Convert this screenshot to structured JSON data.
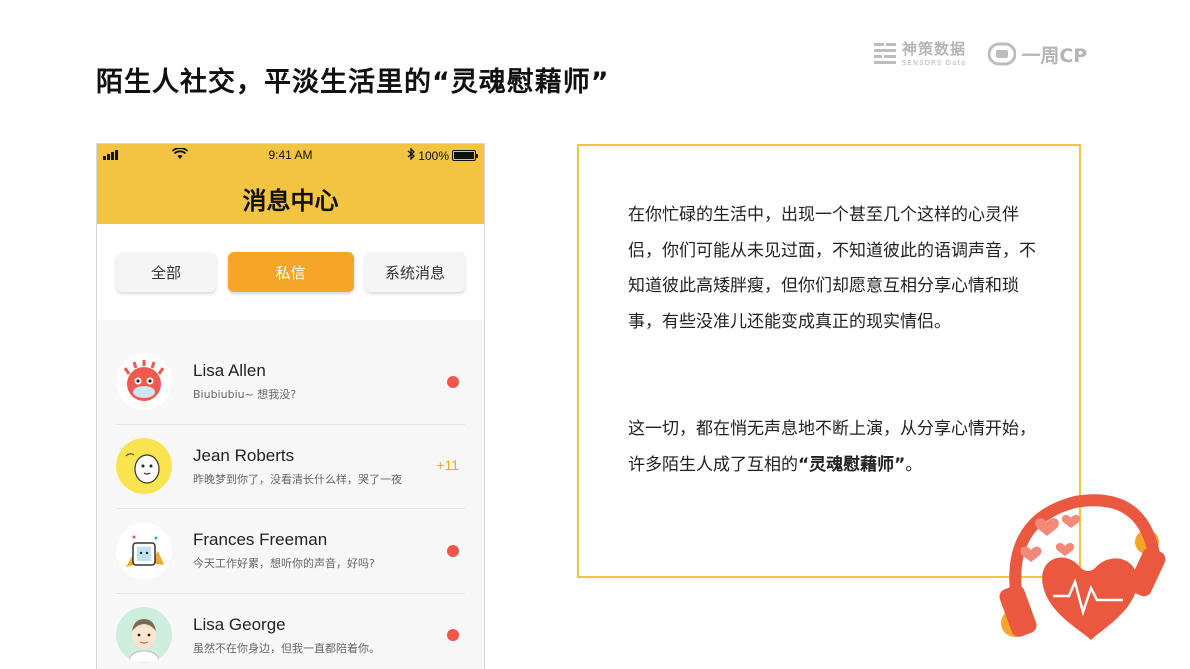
{
  "slide": {
    "title": "陌生人社交，平淡生活里的“灵魂慰藉师”"
  },
  "logos": {
    "sensors_cn": "神策数据",
    "sensors_en": "SENSORS Data",
    "yizhou": "一周CP"
  },
  "phone": {
    "status_time": "9:41 AM",
    "battery_text": "100%",
    "battery_level": 1.0,
    "title": "消息中心",
    "tabs": [
      {
        "label": "全部",
        "active": false
      },
      {
        "label": "私信",
        "active": true
      },
      {
        "label": "系统消息",
        "active": false
      }
    ],
    "messages": [
      {
        "name": "Lisa Allen",
        "preview": "Biubiubiu~ 想我没?",
        "indicator": "dot"
      },
      {
        "name": "Jean Roberts",
        "preview": "昨晚梦到你了，没看清长什么样，哭了一夜",
        "indicator": "badge",
        "badge": "+11"
      },
      {
        "name": "Frances Freeman",
        "preview": "今天工作好累，想听你的声音，好吗?",
        "indicator": "dot"
      },
      {
        "name": "Lisa George",
        "preview": "虽然不在你身边，但我一直都陪着你。",
        "indicator": "dot"
      }
    ]
  },
  "content": {
    "para1": "在你忙碌的生活中，出现一个甚至几个这样的心灵伴侣，你们可能从未见过面，不知道彼此的语调声音，不知道彼此高矮胖瘦，但你们却愿意互相分享心情和琐事，有些没准儿还能变成真正的现实情侣。",
    "para2_before": "这一切，都在悄无声息地不断上演，从分享心情开始，许多陌生人成了互相的",
    "para2_bold": "“灵魂慰藉师”",
    "para2_after": "。"
  },
  "colors": {
    "header_yellow": "#f2c442",
    "active_tab": "#f4a628",
    "unread_dot": "#f2554a",
    "border_yellow": "#f2c442"
  }
}
